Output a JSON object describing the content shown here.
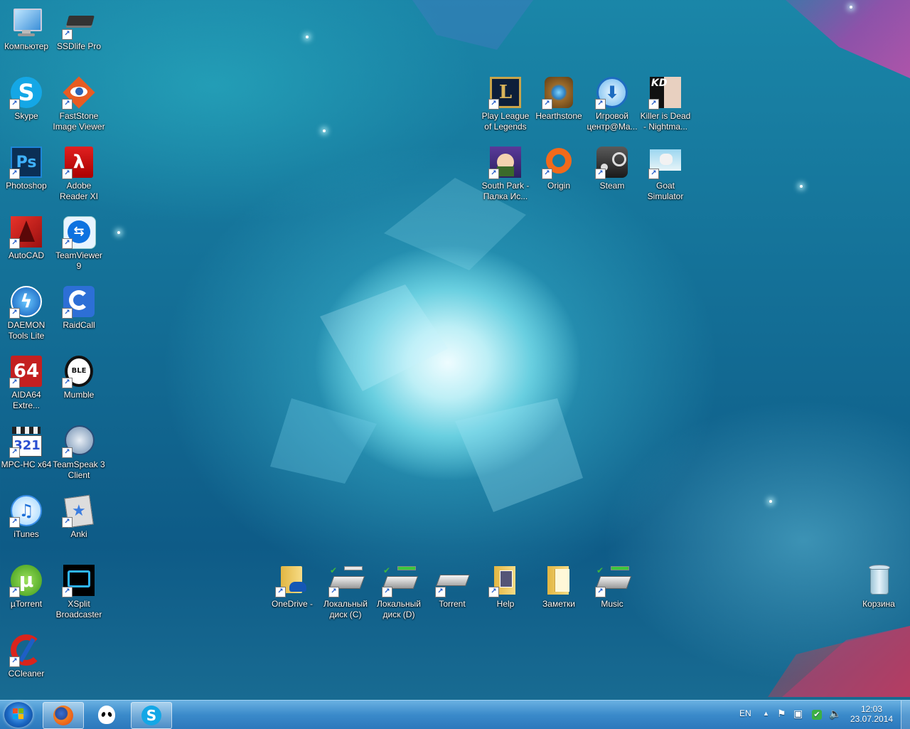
{
  "desktop": {
    "icons": [
      {
        "id": "computer",
        "label": "Компьютер",
        "icon": "computer-icon"
      },
      {
        "id": "ssdlife",
        "label": "SSDlife Pro",
        "icon": "ssd-chip-icon"
      },
      {
        "id": "skype",
        "label": "Skype",
        "icon": "skype-icon"
      },
      {
        "id": "faststone",
        "label": "FastStone Image Viewer",
        "icon": "faststone-eye-icon"
      },
      {
        "id": "photoshop",
        "label": "Photoshop",
        "icon": "photoshop-icon"
      },
      {
        "id": "adobe-reader",
        "label": "Adobe Reader XI",
        "icon": "adobe-reader-icon"
      },
      {
        "id": "autocad",
        "label": "AutoCAD",
        "icon": "autocad-icon"
      },
      {
        "id": "teamviewer",
        "label": "TeamViewer 9",
        "icon": "teamviewer-icon"
      },
      {
        "id": "daemon",
        "label": "DAEMON Tools Lite",
        "icon": "daemon-tools-icon"
      },
      {
        "id": "raidcall",
        "label": "RaidCall",
        "icon": "raidcall-icon"
      },
      {
        "id": "aida64",
        "label": "AIDA64 Extre...",
        "icon": "aida64-icon"
      },
      {
        "id": "mumble",
        "label": "Mumble",
        "icon": "mumble-icon"
      },
      {
        "id": "mpc",
        "label": "MPC-HC x64",
        "icon": "mpc-hc-icon"
      },
      {
        "id": "teamspeak",
        "label": "TeamSpeak 3 Client",
        "icon": "teamspeak-icon"
      },
      {
        "id": "itunes",
        "label": "iTunes",
        "icon": "itunes-icon"
      },
      {
        "id": "anki",
        "label": "Anki",
        "icon": "anki-icon"
      },
      {
        "id": "utorrent",
        "label": "µTorrent",
        "icon": "utorrent-icon"
      },
      {
        "id": "xsplit",
        "label": "XSplit Broadcaster",
        "icon": "xsplit-icon"
      },
      {
        "id": "ccleaner",
        "label": "CCleaner",
        "icon": "ccleaner-icon"
      },
      {
        "id": "lol",
        "label": "Play League of Legends",
        "icon": "league-of-legends-icon"
      },
      {
        "id": "hearthstone",
        "label": "Hearthstone",
        "icon": "hearthstone-icon"
      },
      {
        "id": "game-center",
        "label": "Игровой центр@Ma...",
        "icon": "game-center-icon"
      },
      {
        "id": "killer",
        "label": "Killer is Dead - Nightma...",
        "icon": "killer-is-dead-icon"
      },
      {
        "id": "southpark",
        "label": "South Park - Палка Ис...",
        "icon": "south-park-icon"
      },
      {
        "id": "origin",
        "label": "Origin",
        "icon": "origin-icon"
      },
      {
        "id": "steam",
        "label": "Steam",
        "icon": "steam-icon"
      },
      {
        "id": "goat",
        "label": "Goat Simulator",
        "icon": "goat-simulator-icon"
      },
      {
        "id": "onedrive",
        "label": "OneDrive -",
        "icon": "onedrive-folder-icon"
      },
      {
        "id": "disk-c",
        "label": "Локальный диск (C)",
        "icon": "local-disk-icon"
      },
      {
        "id": "disk-d",
        "label": "Локальный диск (D)",
        "icon": "local-disk-icon"
      },
      {
        "id": "torrent",
        "label": "Torrent",
        "icon": "scanner-icon"
      },
      {
        "id": "help",
        "label": "Help",
        "icon": "help-folder-icon"
      },
      {
        "id": "notes",
        "label": "Заметки",
        "icon": "folder-icon"
      },
      {
        "id": "music",
        "label": "Music",
        "icon": "local-disk-icon"
      },
      {
        "id": "recycle",
        "label": "Корзина",
        "icon": "recycle-bin-icon"
      }
    ]
  },
  "taskbar": {
    "pinned": [
      "firefox-icon",
      "falcon-alien-icon",
      "skype-icon"
    ],
    "language": "EN",
    "time": "12:03",
    "date": "23.07.2014",
    "tray_icons": [
      "show-hidden-icons-chevron",
      "action-center-flag-icon",
      "network-icon",
      "security-check-icon",
      "volume-icon"
    ]
  }
}
